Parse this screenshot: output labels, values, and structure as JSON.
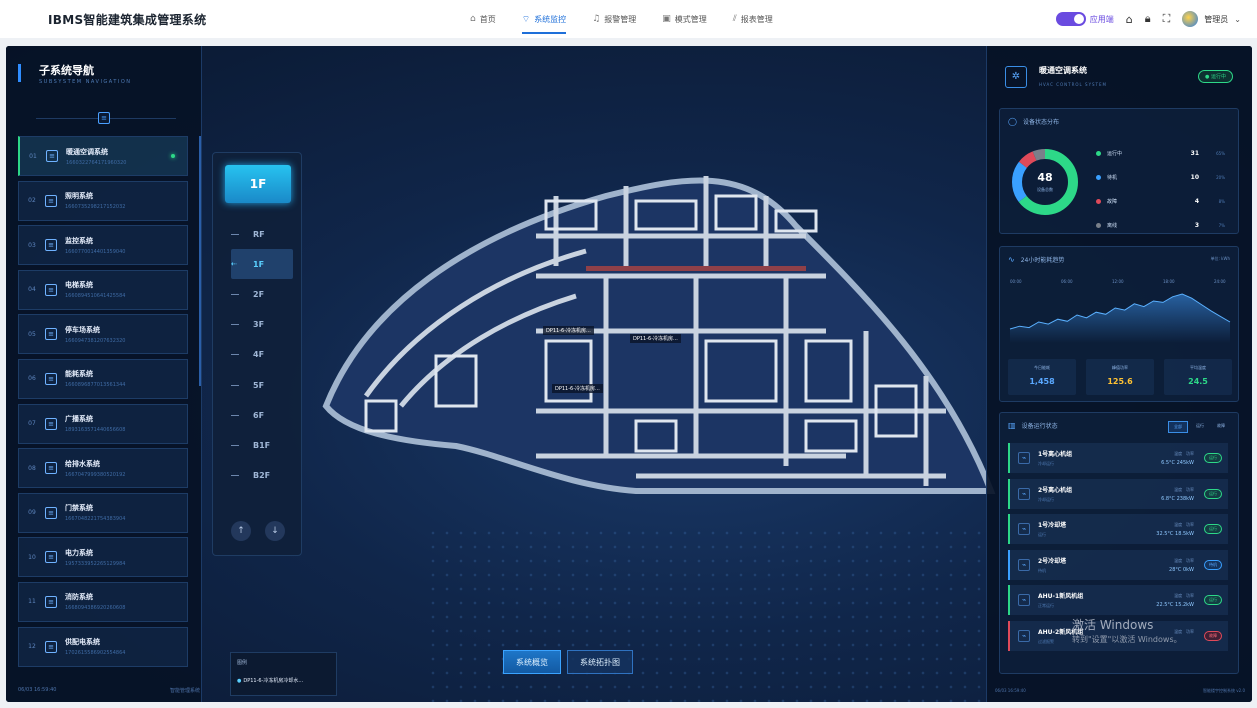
{
  "app": {
    "title": "IBMS智能建筑集成管理系统"
  },
  "nav": [
    {
      "icon": "⌂",
      "label": "首页"
    },
    {
      "icon": "⌔",
      "label": "系统监控"
    },
    {
      "icon": "♫",
      "label": "报警管理"
    },
    {
      "icon": "▣",
      "label": "模式管理"
    },
    {
      "icon": "⫽",
      "label": "报表管理"
    }
  ],
  "topright": {
    "app_label": "应用端",
    "user": "管理员"
  },
  "left": {
    "title": "子系统导航",
    "subtitle": "SUBSYSTEM NAVIGATION",
    "systems": [
      {
        "num": "01",
        "name": "暖通空调系统",
        "code": "1660322764171960320"
      },
      {
        "num": "02",
        "name": "照明系统",
        "code": "1660735298217152032"
      },
      {
        "num": "03",
        "name": "监控系统",
        "code": "1660770014401359040"
      },
      {
        "num": "04",
        "name": "电梯系统",
        "code": "1660894510641425584"
      },
      {
        "num": "05",
        "name": "停车场系统",
        "code": "1660947381207632320"
      },
      {
        "num": "06",
        "name": "能耗系统",
        "code": "1660896877013561344"
      },
      {
        "num": "07",
        "name": "广播系统",
        "code": "1893163571440656608"
      },
      {
        "num": "08",
        "name": "给排水系统",
        "code": "1667047999380520192"
      },
      {
        "num": "09",
        "name": "门禁系统",
        "code": "1667048221754383904"
      },
      {
        "num": "10",
        "name": "电力系统",
        "code": "1957333952265129984"
      },
      {
        "num": "11",
        "name": "消防系统",
        "code": "1668094386920260608"
      },
      {
        "num": "12",
        "name": "供配电系统",
        "code": "1702615586902554864"
      }
    ],
    "footer_time": "06/03 16:59:40",
    "footer_label": "智能管理系统"
  },
  "floors": {
    "current": "1F",
    "list": [
      "RF",
      "1F",
      "2F",
      "3F",
      "4F",
      "5F",
      "6F",
      "B1F",
      "B2F"
    ],
    "selected_index": 1
  },
  "plan": {
    "labels": [
      "DP11-6-冷冻机房...",
      "DP11-6-冷冻机房...",
      "DP11-6-冷冻机房..."
    ]
  },
  "bottom_tabs": [
    "系统概览",
    "系统拓扑图"
  ],
  "legend": {
    "title": "图例",
    "item": "DP11-6-冷冻机房冷却水..."
  },
  "right": {
    "title": "暖通空调系统",
    "subtitle": "HVAC CONTROL SYSTEM",
    "badge": "● 运行中",
    "status_title": "设备状态分布",
    "total": "48",
    "total_label": "设备总数",
    "dist": [
      {
        "label": "运行中",
        "value": 31,
        "pct": "65%",
        "color": "#2dd888"
      },
      {
        "label": "待机",
        "value": 10,
        "pct": "20%",
        "color": "#3aa0ff"
      },
      {
        "label": "故障",
        "value": 4,
        "pct": "8%",
        "color": "#e04a5a"
      },
      {
        "label": "离线",
        "value": 3,
        "pct": "7%",
        "color": "#7a808a"
      }
    ],
    "trend_title": "24小时能耗趋势",
    "trend_unit": "单位: kWh",
    "trend_ticks": [
      "00:00",
      "06:00",
      "12:00",
      "18:00",
      "24:00"
    ],
    "trend_values": [
      20,
      24,
      22,
      30,
      27,
      34,
      31,
      40,
      36,
      44,
      41,
      50,
      47,
      56,
      52,
      60,
      58,
      66,
      70,
      64,
      55,
      46,
      38,
      30
    ],
    "stats": [
      {
        "label": "今日能耗",
        "value": "1,458",
        "color": "#5aa8ff"
      },
      {
        "label": "峰值功率",
        "value": "125.6",
        "color": "#ffc233"
      },
      {
        "label": "平均温度",
        "value": "24.5",
        "color": "#2dd888"
      }
    ],
    "devices_title": "设备运行状态",
    "filters": [
      "全部",
      "运行",
      "故障"
    ],
    "devices": [
      {
        "name": "1号离心机组",
        "state": "冷却运行",
        "h1": "温度",
        "h2": "功率",
        "v1": "6.5°C",
        "v2": "245kW",
        "pill": "运行",
        "kind": "run"
      },
      {
        "name": "2号离心机组",
        "state": "冷却运行",
        "h1": "温度",
        "h2": "功率",
        "v1": "6.8°C",
        "v2": "238kW",
        "pill": "运行",
        "kind": "run"
      },
      {
        "name": "1号冷却塔",
        "state": "运行",
        "h1": "温度",
        "h2": "功率",
        "v1": "32.5°C",
        "v2": "18.5kW",
        "pill": "运行",
        "kind": "run"
      },
      {
        "name": "2号冷却塔",
        "state": "待机",
        "h1": "温度",
        "h2": "功率",
        "v1": "28°C",
        "v2": "0kW",
        "pill": "待机",
        "kind": "idle"
      },
      {
        "name": "AHU-1新风机组",
        "state": "正常运行",
        "h1": "温度",
        "h2": "功率",
        "v1": "22.5°C",
        "v2": "15.2kW",
        "pill": "运行",
        "kind": "run"
      },
      {
        "name": "AHU-2新风机组",
        "state": "过滤报警",
        "h1": "温度",
        "h2": "功率",
        "v1": "",
        "v2": "",
        "pill": "故障",
        "kind": "fault"
      }
    ],
    "footer_time": "06/03 16:59:40",
    "footer_label": "智能楼宇控制系统 v2.0"
  },
  "watermark": {
    "title": "激活 Windows",
    "sub": "转到\"设置\"以激活 Windows。"
  }
}
